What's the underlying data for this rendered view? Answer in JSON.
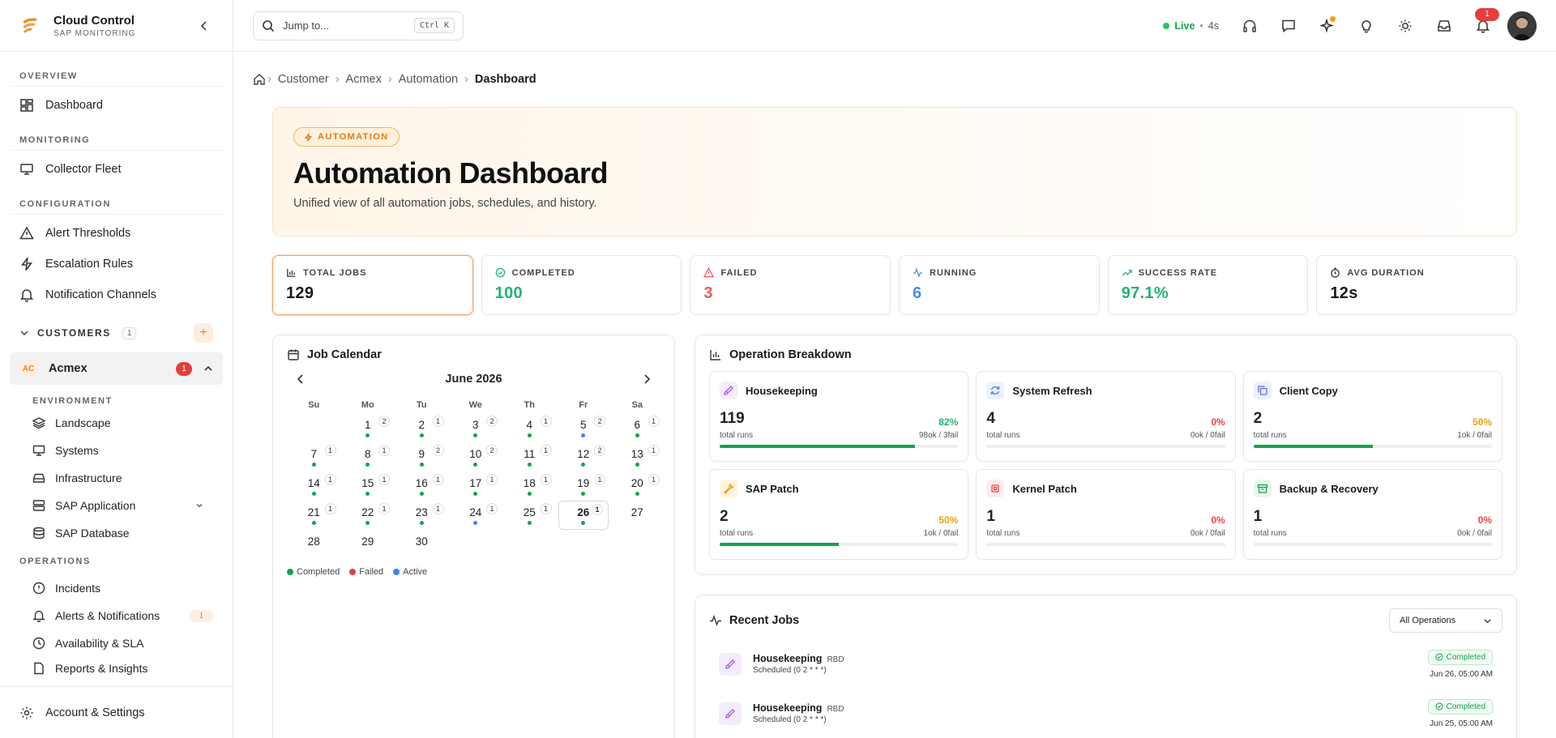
{
  "brand": {
    "name": "Cloud Control",
    "sub": "SAP MONITORING"
  },
  "nav": {
    "overview_label": "OVERVIEW",
    "dashboard": "Dashboard",
    "monitoring_label": "MONITORING",
    "collector_fleet": "Collector Fleet",
    "configuration_label": "CONFIGURATION",
    "alert_thresholds": "Alert Thresholds",
    "escalation_rules": "Escalation Rules",
    "notification_channels": "Notification Channels",
    "customers_label": "CUSTOMERS",
    "customers_count": "1",
    "customer": {
      "initials": "AC",
      "name": "Acmex",
      "badge": "1"
    },
    "environment_label": "ENVIRONMENT",
    "landscape": "Landscape",
    "systems": "Systems",
    "infrastructure": "Infrastructure",
    "sap_application": "SAP Application",
    "sap_database": "SAP Database",
    "operations_label": "OPERATIONS",
    "incidents": "Incidents",
    "alerts_notifications": "Alerts & Notifications",
    "alerts_badge": "1",
    "availability_sla": "Availability & SLA",
    "reports_insights": "Reports & Insights",
    "account_settings": "Account & Settings"
  },
  "topbar": {
    "search_placeholder": "Jump to...",
    "shortcut": "Ctrl K",
    "live_label": "Live",
    "live_sep": "•",
    "live_secs": "4s",
    "notif_count": "1"
  },
  "breadcrumb": {
    "items": [
      "Customer",
      "Acmex",
      "Automation"
    ],
    "current": "Dashboard"
  },
  "hero": {
    "tag": "AUTOMATION",
    "title": "Automation Dashboard",
    "subtitle": "Unified view of all automation jobs, schedules, and history."
  },
  "stats": [
    {
      "label": "TOTAL JOBS",
      "value": "129",
      "color": "#1a1a1a"
    },
    {
      "label": "COMPLETED",
      "value": "100",
      "color": "#22b573"
    },
    {
      "label": "FAILED",
      "value": "3",
      "color": "#ef5b5b"
    },
    {
      "label": "RUNNING",
      "value": "6",
      "color": "#4a90e2"
    },
    {
      "label": "SUCCESS RATE",
      "value": "97.1%",
      "color": "#22b573"
    },
    {
      "label": "AVG DURATION",
      "value": "12s",
      "color": "#1a1a1a"
    }
  ],
  "calendar": {
    "title": "Job Calendar",
    "month": "June 2026",
    "weekdays": [
      "Su",
      "Mo",
      "Tu",
      "We",
      "Th",
      "Fr",
      "Sa"
    ],
    "leading_blanks": 1,
    "today": 26,
    "days": [
      {
        "d": "1",
        "c": "2",
        "s": [
          "g"
        ]
      },
      {
        "d": "2",
        "c": "1",
        "s": [
          "g"
        ]
      },
      {
        "d": "3",
        "c": "2",
        "s": [
          "g"
        ]
      },
      {
        "d": "4",
        "c": "1",
        "s": [
          "g"
        ]
      },
      {
        "d": "5",
        "c": "2",
        "s": [
          "b"
        ]
      },
      {
        "d": "6",
        "c": "1",
        "s": [
          "g"
        ]
      },
      {
        "d": "7",
        "c": "1",
        "s": [
          "g"
        ]
      },
      {
        "d": "8",
        "c": "1",
        "s": [
          "g"
        ]
      },
      {
        "d": "9",
        "c": "2",
        "s": [
          "g"
        ]
      },
      {
        "d": "10",
        "c": "2",
        "s": [
          "g"
        ]
      },
      {
        "d": "11",
        "c": "1",
        "s": [
          "g"
        ]
      },
      {
        "d": "12",
        "c": "2",
        "s": [
          "g"
        ]
      },
      {
        "d": "13",
        "c": "1",
        "s": [
          "g"
        ]
      },
      {
        "d": "14",
        "c": "1",
        "s": [
          "g"
        ]
      },
      {
        "d": "15",
        "c": "1",
        "s": [
          "g"
        ]
      },
      {
        "d": "16",
        "c": "1",
        "s": [
          "g"
        ]
      },
      {
        "d": "17",
        "c": "1",
        "s": [
          "g"
        ]
      },
      {
        "d": "18",
        "c": "1",
        "s": [
          "g"
        ]
      },
      {
        "d": "19",
        "c": "1",
        "s": [
          "g"
        ]
      },
      {
        "d": "20",
        "c": "1",
        "s": [
          "g"
        ]
      },
      {
        "d": "21",
        "c": "1",
        "s": [
          "g"
        ]
      },
      {
        "d": "22",
        "c": "1",
        "s": [
          "g"
        ]
      },
      {
        "d": "23",
        "c": "1",
        "s": [
          "g"
        ]
      },
      {
        "d": "24",
        "c": "1",
        "s": [
          "b"
        ]
      },
      {
        "d": "25",
        "c": "1",
        "s": [
          "g"
        ]
      },
      {
        "d": "26",
        "c": "1",
        "s": [
          "g"
        ]
      },
      {
        "d": "27",
        "c": "",
        "s": []
      },
      {
        "d": "28",
        "c": "",
        "s": []
      },
      {
        "d": "29",
        "c": "",
        "s": []
      },
      {
        "d": "30",
        "c": "",
        "s": []
      }
    ],
    "legend": [
      {
        "label": "Completed",
        "color": "#16a34a"
      },
      {
        "label": "Failed",
        "color": "#e53e3e"
      },
      {
        "label": "Active",
        "color": "#3b82f6"
      }
    ]
  },
  "operations": {
    "title": "Operation Breakdown",
    "items": [
      {
        "name": "Housekeeping",
        "count": "119",
        "pct": "82%",
        "fraction": 0.82,
        "pct_color": "#22b573",
        "sub": "total runs",
        "ratio": "98ok / 3fail",
        "icon_bg": "#f4ecfb",
        "icon_color": "#a855f7",
        "icon": "brush-icon"
      },
      {
        "name": "System Refresh",
        "count": "4",
        "pct": "0%",
        "fraction": 0,
        "pct_color": "#ef4444",
        "sub": "total runs",
        "ratio": "0ok / 0fail",
        "icon_bg": "#eaf2fd",
        "icon_color": "#3b82f6",
        "icon": "refresh-icon"
      },
      {
        "name": "Client Copy",
        "count": "2",
        "pct": "50%",
        "fraction": 0.5,
        "pct_color": "#f59e0b",
        "sub": "total runs",
        "ratio": "1ok / 0fail",
        "icon_bg": "#eef0fd",
        "icon_color": "#6366f1",
        "icon": "copy-icon"
      },
      {
        "name": "SAP Patch",
        "count": "2",
        "pct": "50%",
        "fraction": 0.5,
        "pct_color": "#f59e0b",
        "sub": "total runs",
        "ratio": "1ok / 0fail",
        "icon_bg": "#fff3e0",
        "icon_color": "#f59e0b",
        "icon": "wrench-icon"
      },
      {
        "name": "Kernel Patch",
        "count": "1",
        "pct": "0%",
        "fraction": 0,
        "pct_color": "#ef4444",
        "sub": "total runs",
        "ratio": "0ok / 0fail",
        "icon_bg": "#fdecee",
        "icon_color": "#ef4444",
        "icon": "cpu-icon"
      },
      {
        "name": "Backup & Recovery",
        "count": "1",
        "pct": "0%",
        "fraction": 0,
        "pct_color": "#ef4444",
        "sub": "total runs",
        "ratio": "0ok / 0fail",
        "icon_bg": "#e8f7ef",
        "icon_color": "#16a34a",
        "icon": "archive-icon"
      }
    ]
  },
  "recent_jobs": {
    "title": "Recent Jobs",
    "filter": "All Operations",
    "items": [
      {
        "name": "Housekeeping",
        "tag": "RBD",
        "schedule": "Scheduled (0 2 * * *)",
        "status": "Completed",
        "time": "Jun 26, 05:00 AM"
      },
      {
        "name": "Housekeeping",
        "tag": "RBD",
        "schedule": "Scheduled (0 2 * * *)",
        "status": "Completed",
        "time": "Jun 25, 05:00 AM"
      }
    ]
  }
}
